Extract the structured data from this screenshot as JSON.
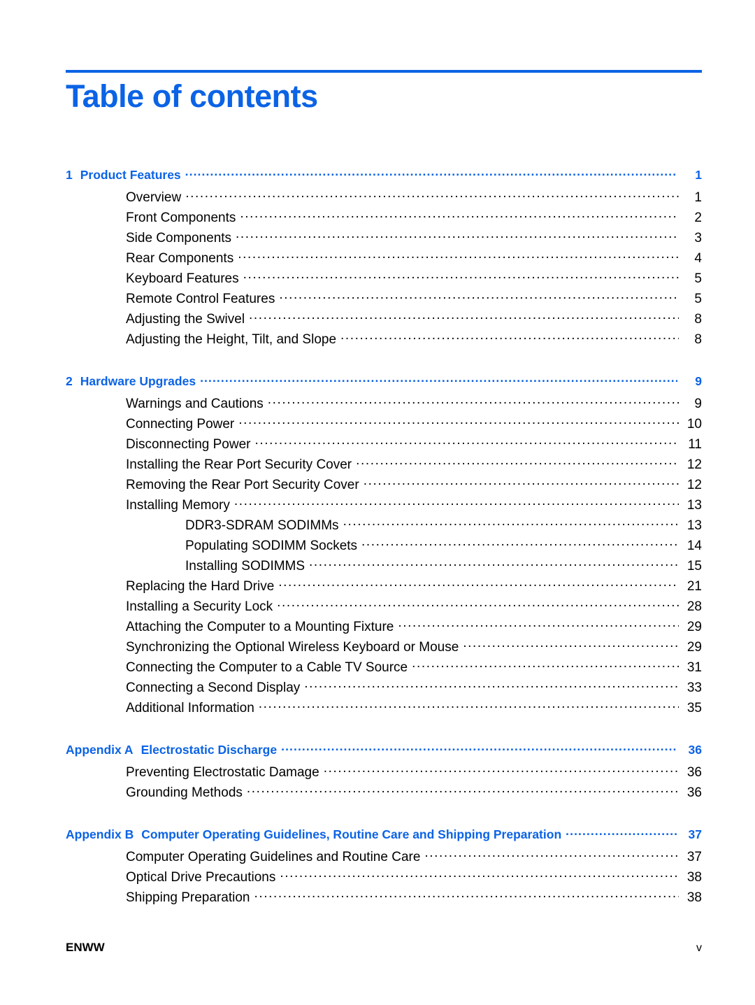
{
  "document": {
    "title": "Table of contents",
    "accent_color": "#0b63e5",
    "text_color": "#000000",
    "background_color": "#ffffff"
  },
  "footer": {
    "left_label": "ENWW",
    "page_number": "v"
  },
  "toc": {
    "groups": [
      {
        "heading": {
          "number": "1",
          "label": "Product Features",
          "page": "1"
        },
        "entries": [
          {
            "level": 2,
            "label": "Overview",
            "page": "1"
          },
          {
            "level": 2,
            "label": "Front Components",
            "page": "2"
          },
          {
            "level": 2,
            "label": "Side Components",
            "page": "3"
          },
          {
            "level": 2,
            "label": "Rear Components",
            "page": "4"
          },
          {
            "level": 2,
            "label": "Keyboard Features",
            "page": "5"
          },
          {
            "level": 2,
            "label": "Remote Control Features",
            "page": "5"
          },
          {
            "level": 2,
            "label": "Adjusting the Swivel",
            "page": "8"
          },
          {
            "level": 2,
            "label": "Adjusting the Height, Tilt, and Slope",
            "page": "8"
          }
        ]
      },
      {
        "heading": {
          "number": "2",
          "label": "Hardware Upgrades",
          "page": "9"
        },
        "entries": [
          {
            "level": 2,
            "label": "Warnings and Cautions",
            "page": "9"
          },
          {
            "level": 2,
            "label": "Connecting Power",
            "page": "10"
          },
          {
            "level": 2,
            "label": "Disconnecting Power",
            "page": "11"
          },
          {
            "level": 2,
            "label": "Installing the Rear Port Security Cover",
            "page": "12"
          },
          {
            "level": 2,
            "label": "Removing the Rear Port Security Cover",
            "page": "12"
          },
          {
            "level": 2,
            "label": "Installing Memory",
            "page": "13"
          },
          {
            "level": 3,
            "label": "DDR3-SDRAM SODIMMs",
            "page": "13"
          },
          {
            "level": 3,
            "label": "Populating SODIMM Sockets",
            "page": "14"
          },
          {
            "level": 3,
            "label": "Installing SODIMMS",
            "page": "15"
          },
          {
            "level": 2,
            "label": "Replacing the Hard Drive",
            "page": "21"
          },
          {
            "level": 2,
            "label": "Installing a Security Lock",
            "page": "28"
          },
          {
            "level": 2,
            "label": "Attaching the Computer to a Mounting Fixture",
            "page": "29"
          },
          {
            "level": 2,
            "label": "Synchronizing the Optional Wireless Keyboard or Mouse",
            "page": "29"
          },
          {
            "level": 2,
            "label": "Connecting the Computer to a Cable TV Source",
            "page": "31"
          },
          {
            "level": 2,
            "label": "Connecting a Second Display",
            "page": "33"
          },
          {
            "level": 2,
            "label": "Additional Information",
            "page": "35"
          }
        ]
      },
      {
        "heading": {
          "number": "Appendix A",
          "label": "Electrostatic Discharge",
          "page": "36"
        },
        "entries": [
          {
            "level": 2,
            "label": "Preventing Electrostatic Damage",
            "page": "36"
          },
          {
            "level": 2,
            "label": "Grounding Methods",
            "page": "36"
          }
        ]
      },
      {
        "heading": {
          "number": "Appendix B",
          "label": "Computer Operating Guidelines, Routine Care and Shipping Preparation",
          "page": "37"
        },
        "entries": [
          {
            "level": 2,
            "label": "Computer Operating Guidelines and Routine Care",
            "page": "37"
          },
          {
            "level": 2,
            "label": "Optical Drive Precautions",
            "page": "38"
          },
          {
            "level": 2,
            "label": "Shipping Preparation",
            "page": "38"
          }
        ]
      }
    ]
  }
}
